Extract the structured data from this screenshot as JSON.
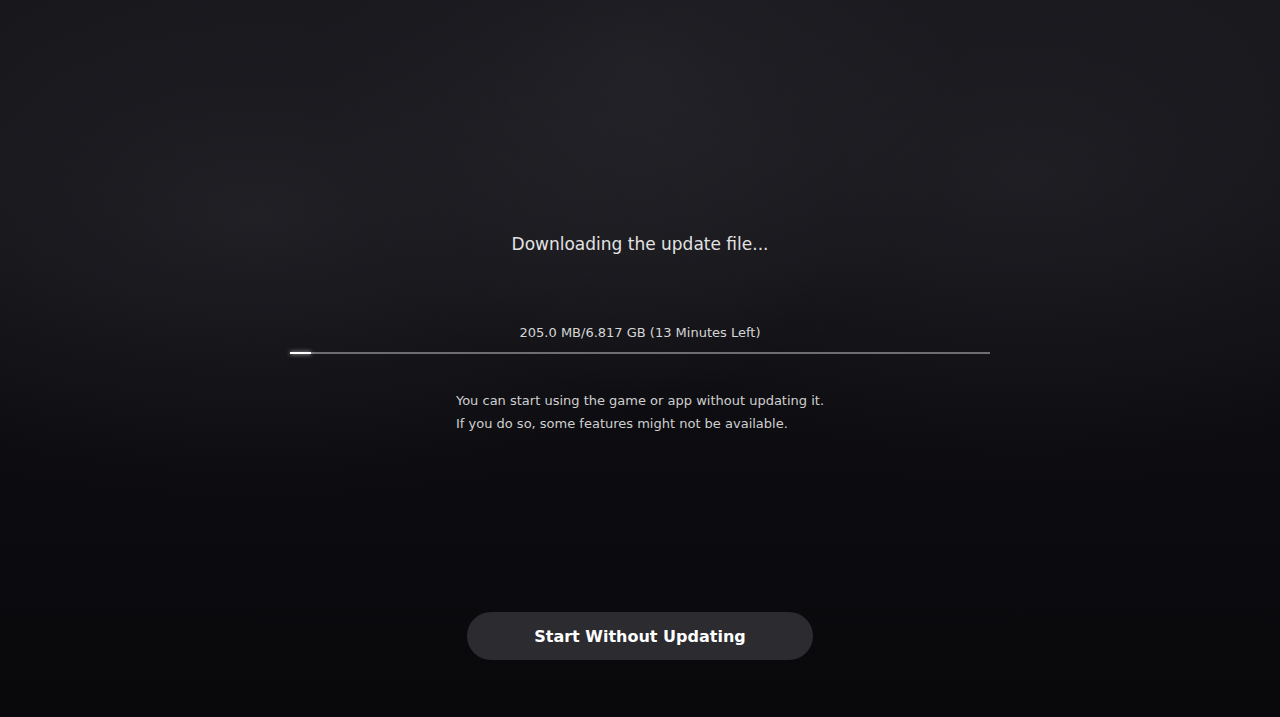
{
  "screen": {
    "title": "Downloading the update file..."
  },
  "progress": {
    "reading": "205.0 MB/6.817 GB (13 Minutes Left)",
    "level": 0.03
  },
  "notes": [
    "You can start using the game or app without updating it.",
    "If you do so, some features might not be available."
  ],
  "buttons": [
    {
      "label": "Start Without Updating",
      "selected": true
    }
  ]
}
